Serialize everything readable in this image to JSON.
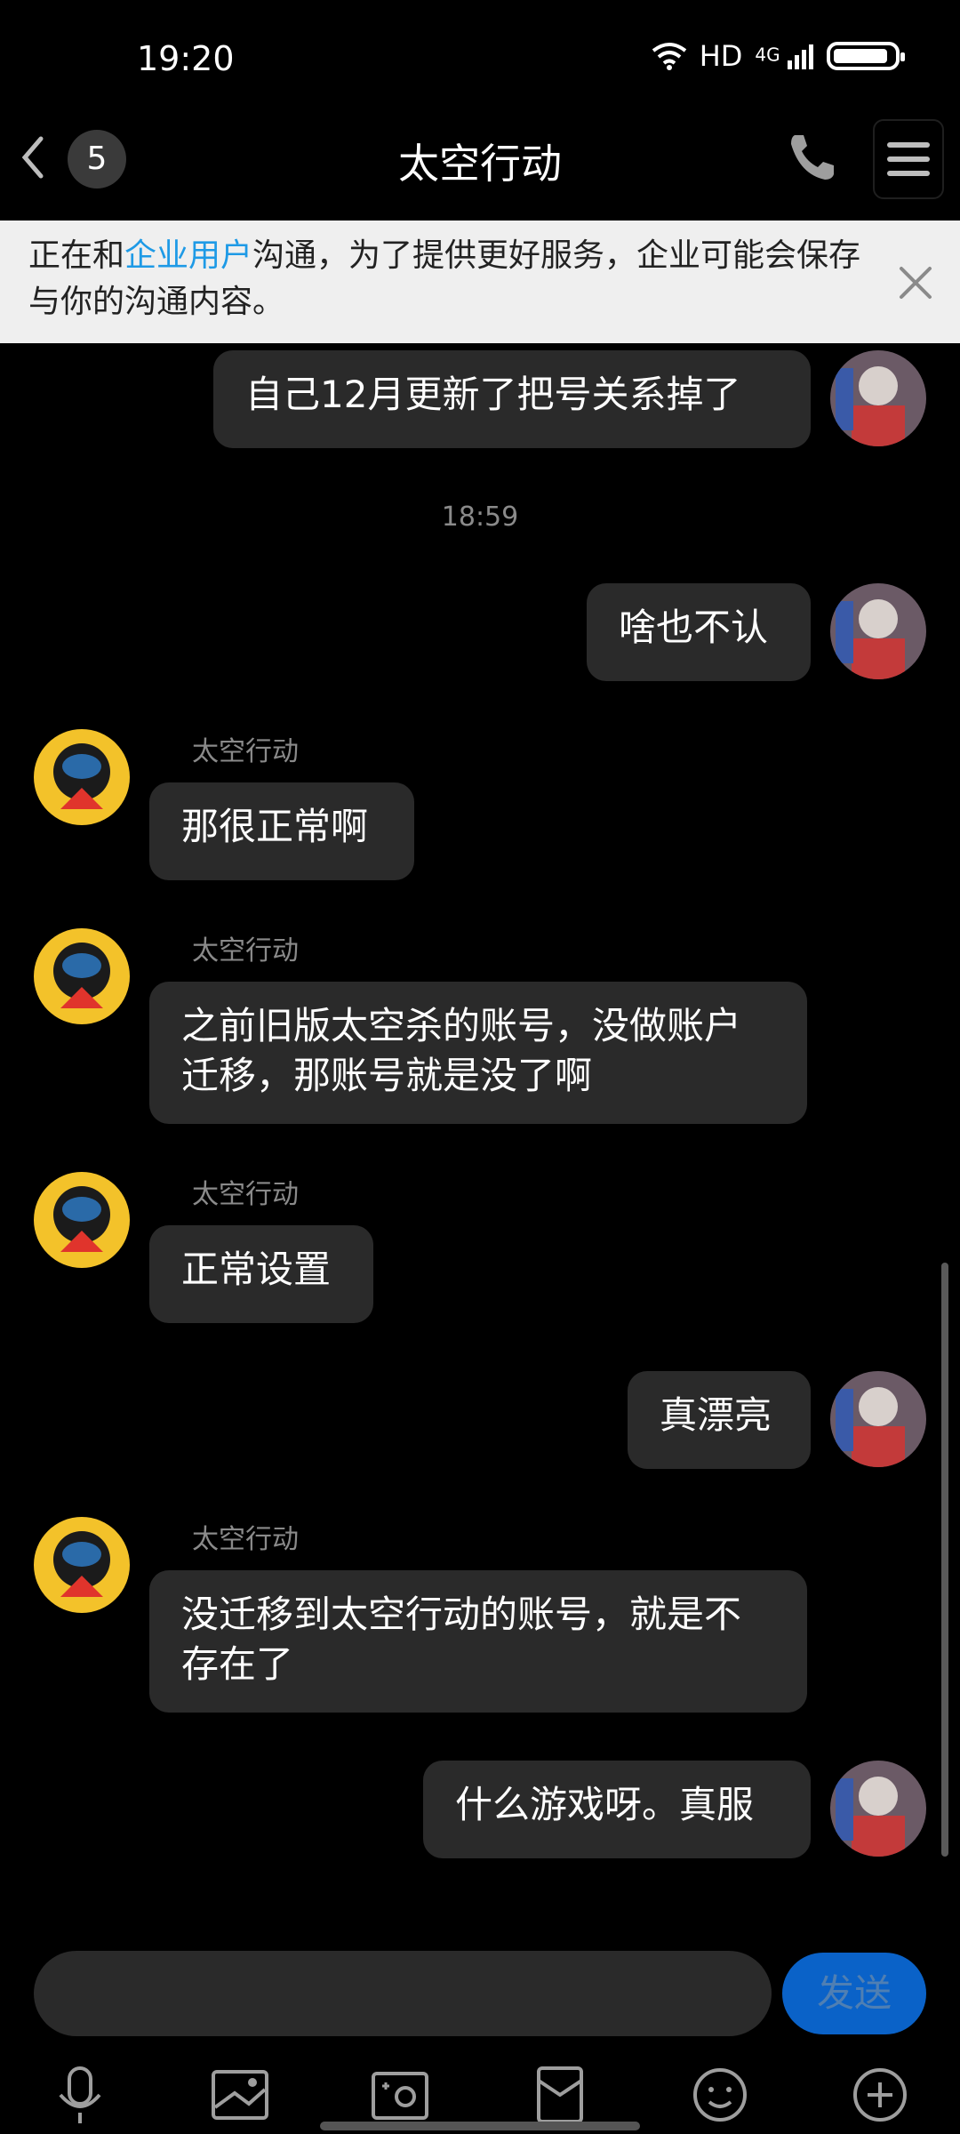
{
  "status_bar": {
    "time": "19:20",
    "network": "HD",
    "signal": "4G"
  },
  "header": {
    "unread_count": "5",
    "title": "太空行动"
  },
  "banner": {
    "prefix": "正在和",
    "link": "企业用户",
    "suffix": "沟通，为了提供更好服务，企业可能会保存与你的沟通内容。"
  },
  "messages": {
    "m1": "自己12月更新了把号关系掉了",
    "timestamp": "18:59",
    "m2": "啥也不认",
    "bot_name": "太空行动",
    "m3": "那很正常啊",
    "m4": "之前旧版太空杀的账号，没做账户迁移，那账号就是没了啊",
    "m5": "正常设置",
    "m6": "真漂亮",
    "m7": "没迁移到太空行动的账号，就是不存在了",
    "m8": "什么游戏呀。真服"
  },
  "input": {
    "send_label": "发送"
  },
  "toolbar": [
    "microphone-icon",
    "image-icon",
    "camera-icon",
    "red-packet-icon",
    "emoji-icon",
    "plus-icon"
  ],
  "colors": {
    "bubble": "#2a2a2a",
    "link": "#1e9ae6",
    "send": "#0a62c8"
  }
}
